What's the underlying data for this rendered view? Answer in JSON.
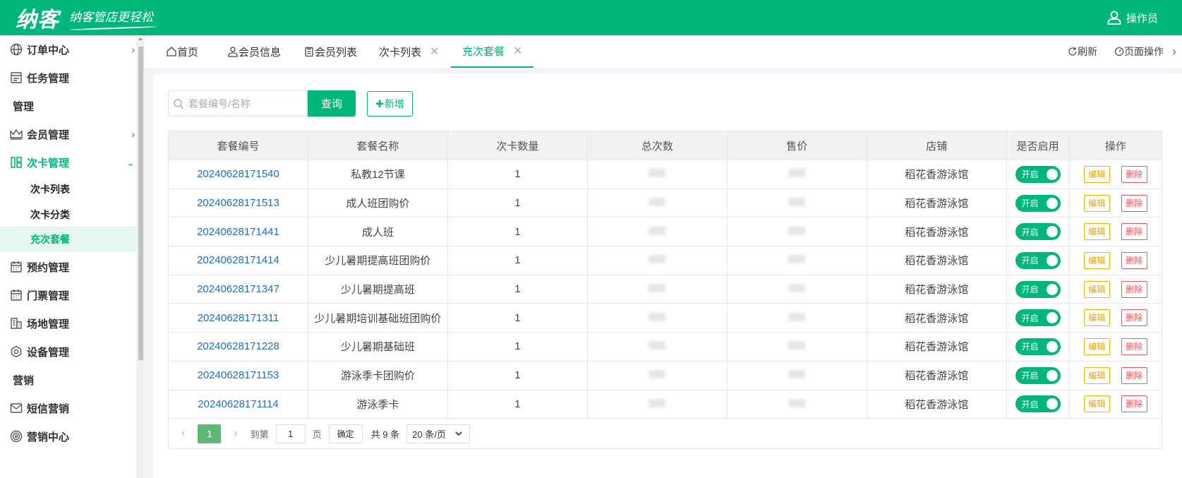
{
  "header": {
    "logo": "纳客",
    "slogan": "纳客管店更轻松",
    "user_label": "操作员"
  },
  "sidebar": {
    "items": [
      {
        "label": "订单中心",
        "icon": "globe-icon"
      },
      {
        "label": "任务管理",
        "icon": "task-icon"
      },
      {
        "label": "管理"
      },
      {
        "label": "会员管理",
        "icon": "crown-icon"
      },
      {
        "label": "次卡管理",
        "icon": "card-icon"
      },
      {
        "label": "次卡列表"
      },
      {
        "label": "次卡分类"
      },
      {
        "label": "充次套餐"
      },
      {
        "label": "预约管理",
        "icon": "calendar-icon"
      },
      {
        "label": "门票管理",
        "icon": "calendar-icon"
      },
      {
        "label": "场地管理",
        "icon": "building-icon"
      },
      {
        "label": "设备管理",
        "icon": "gear-icon"
      },
      {
        "label": "营销"
      },
      {
        "label": "短信营销",
        "icon": "mail-icon"
      },
      {
        "label": "营销中心",
        "icon": "target-icon"
      }
    ]
  },
  "tabs": [
    {
      "label": "首页",
      "icon": "home-icon"
    },
    {
      "label": "会员信息",
      "icon": "user-icon"
    },
    {
      "label": "会员列表",
      "icon": "clipboard-icon"
    },
    {
      "label": "次卡列表"
    },
    {
      "label": "充次套餐"
    }
  ],
  "tab_tools": {
    "refresh": "刷新",
    "page_ops": "页面操作"
  },
  "search": {
    "placeholder": "套餐编号/名称",
    "query": "查询",
    "add": "新增"
  },
  "table": {
    "headers": [
      "套餐编号",
      "套餐名称",
      "次卡数量",
      "总次数",
      "售价",
      "店铺",
      "是否启用",
      "操作"
    ],
    "rows": [
      {
        "code": "20240628171540",
        "name": "私教12节课",
        "count": "1",
        "store": "稻花香游泳馆"
      },
      {
        "code": "20240628171513",
        "name": "成人班团购价",
        "count": "1",
        "store": "稻花香游泳馆"
      },
      {
        "code": "20240628171441",
        "name": "成人班",
        "count": "1",
        "store": "稻花香游泳馆"
      },
      {
        "code": "20240628171414",
        "name": "少儿暑期提高班团购价",
        "count": "1",
        "store": "稻花香游泳馆"
      },
      {
        "code": "20240628171347",
        "name": "少儿暑期提高班",
        "count": "1",
        "store": "稻花香游泳馆"
      },
      {
        "code": "20240628171311",
        "name": "少儿暑期培训基础班团购价",
        "count": "1",
        "store": "稻花香游泳馆"
      },
      {
        "code": "20240628171228",
        "name": "少儿暑期基础班",
        "count": "1",
        "store": "稻花香游泳馆"
      },
      {
        "code": "20240628171153",
        "name": "游泳季卡团购价",
        "count": "1",
        "store": "稻花香游泳馆"
      },
      {
        "code": "20240628171114",
        "name": "游泳季卡",
        "count": "1",
        "store": "稻花香游泳馆"
      }
    ],
    "toggle_label": "开启",
    "edit_label": "编辑",
    "delete_label": "删除"
  },
  "pager": {
    "current": "1",
    "goto": "到第",
    "page_input": "1",
    "page_unit": "页",
    "confirm": "确定",
    "total": "共 9 条",
    "page_size": "20 条/页"
  },
  "colors": {
    "brand": "#00b77b",
    "link": "#1f6fbf",
    "edit": "#f5a300",
    "delete": "#f0555a"
  }
}
